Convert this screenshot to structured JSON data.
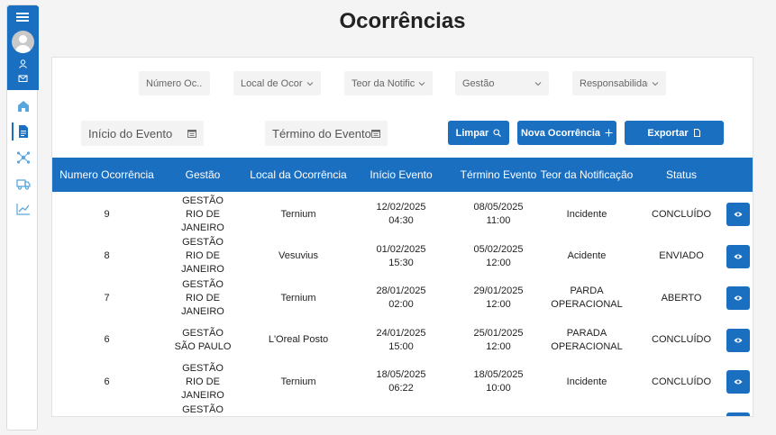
{
  "page": {
    "title": "Ocorrências"
  },
  "filters": {
    "numero": "Número Oc...",
    "local": "Local de Ocorrência",
    "teor": "Teor da Notificação",
    "gestao": "Gestão",
    "responsabilidade": "Responsabilidade"
  },
  "dates": {
    "inicio": "Início do Evento",
    "termino": "Término do Evento"
  },
  "buttons": {
    "limpar": "Limpar",
    "nova": "Nova Ocorrência",
    "exportar": "Exportar"
  },
  "table": {
    "columns": [
      "Numero Ocorrência",
      "Gestão",
      "Local da Ocorrência",
      "Início Evento",
      "Término Evento",
      "Teor da Notificação",
      "Status"
    ],
    "rows": [
      [
        "9",
        "GESTÃO RIO DE JANEIRO",
        "Ternium",
        "12/02/2025 04:30",
        "08/05/2025 11:00",
        "Incidente",
        "CONCLUÍDO"
      ],
      [
        "8",
        "GESTÃO RIO DE JANEIRO",
        "Vesuvius",
        "01/02/2025 15:30",
        "05/02/2025 12:00",
        "Acidente",
        "ENVIADO"
      ],
      [
        "7",
        "GESTÃO RIO DE JANEIRO",
        "Ternium",
        "28/01/2025 02:00",
        "29/01/2025 12:00",
        "PARDA OPERACIONAL",
        "ABERTO"
      ],
      [
        "6",
        "GESTÃO SÃO PAULO",
        "L'Oreal Posto",
        "24/01/2025 15:00",
        "25/01/2025 12:00",
        "PARADA OPERACIONAL",
        "CONCLUÍDO"
      ],
      [
        "6",
        "GESTÃO RIO DE JANEIRO",
        "Ternium",
        "18/05/2025 06:22",
        "18/05/2025 10:00",
        "Incidente",
        "CONCLUÍDO"
      ],
      [
        "",
        "GESTÃO RIO DE",
        "",
        "",
        "",
        "",
        ""
      ]
    ]
  },
  "colors": {
    "primary": "#1a6fc1"
  }
}
